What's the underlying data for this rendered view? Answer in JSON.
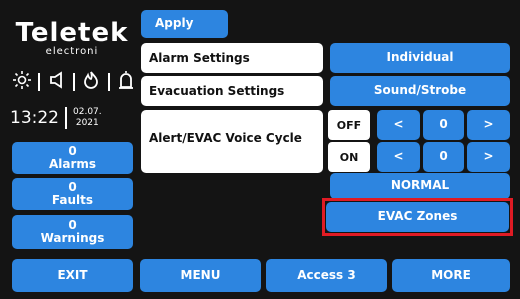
{
  "logo": {
    "brand": "Teletek",
    "subtitle": "electroni"
  },
  "status": {
    "time": "13:22",
    "date_top": "02.07.",
    "date_bottom": "2021"
  },
  "counters": {
    "alarms": {
      "count": "0",
      "label": "Alarms"
    },
    "faults": {
      "count": "0",
      "label": "Faults"
    },
    "warnings": {
      "count": "0",
      "label": "Warnings"
    }
  },
  "apply_label": "Apply",
  "settings": {
    "alarm_settings": "Alarm Settings",
    "evacuation_settings": "Evacuation Settings",
    "voice_cycle": "Alert/EVAC Voice Cycle",
    "individual": "Individual",
    "sound_strobe": "Sound/Strobe",
    "off_label": "OFF",
    "on_label": "ON",
    "off_value": "0",
    "on_value": "0",
    "prev": "<",
    "next": ">",
    "normal": "NORMAL",
    "evac_zones": "EVAC Zones"
  },
  "footer": {
    "exit": "EXIT",
    "menu": "MENU",
    "access": "Access 3",
    "more": "MORE"
  },
  "colors": {
    "accent": "#2d85e0",
    "background": "#141414",
    "highlight": "#e01b24"
  }
}
